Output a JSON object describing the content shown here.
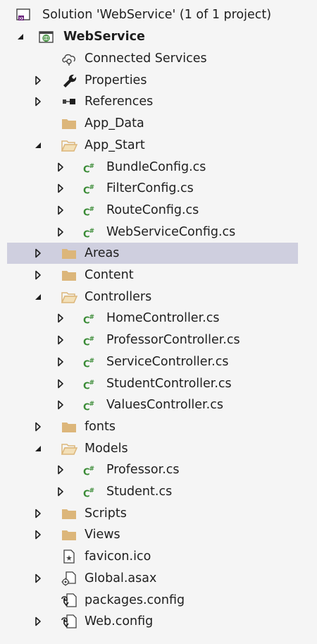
{
  "solution_explorer": {
    "solution_label": "Solution 'WebService' (1 of 1 project)",
    "project_label": "WebService",
    "items": [
      {
        "label": "Connected Services",
        "icon": "connected-services-icon",
        "expander": "none",
        "level": 1
      },
      {
        "label": "Properties",
        "icon": "wrench-icon",
        "expander": "collapsed",
        "level": 1
      },
      {
        "label": "References",
        "icon": "references-icon",
        "expander": "collapsed",
        "level": 1
      },
      {
        "label": "App_Data",
        "icon": "folder-icon",
        "expander": "none",
        "level": 1
      },
      {
        "label": "App_Start",
        "icon": "folder-open-icon",
        "expander": "expanded",
        "level": 1
      },
      {
        "label": "BundleConfig.cs",
        "icon": "csharp-file-icon",
        "expander": "collapsed",
        "level": 2
      },
      {
        "label": "FilterConfig.cs",
        "icon": "csharp-file-icon",
        "expander": "collapsed",
        "level": 2
      },
      {
        "label": "RouteConfig.cs",
        "icon": "csharp-file-icon",
        "expander": "collapsed",
        "level": 2
      },
      {
        "label": "WebServiceConfig.cs",
        "icon": "csharp-file-icon",
        "expander": "collapsed",
        "level": 2
      },
      {
        "label": "Areas",
        "icon": "folder-icon",
        "expander": "collapsed",
        "level": 1,
        "selected": true
      },
      {
        "label": "Content",
        "icon": "folder-icon",
        "expander": "collapsed",
        "level": 1
      },
      {
        "label": "Controllers",
        "icon": "folder-open-icon",
        "expander": "expanded",
        "level": 1
      },
      {
        "label": "HomeController.cs",
        "icon": "csharp-file-icon",
        "expander": "collapsed",
        "level": 2
      },
      {
        "label": "ProfessorController.cs",
        "icon": "csharp-file-icon",
        "expander": "collapsed",
        "level": 2
      },
      {
        "label": "ServiceController.cs",
        "icon": "csharp-file-icon",
        "expander": "collapsed",
        "level": 2
      },
      {
        "label": "StudentController.cs",
        "icon": "csharp-file-icon",
        "expander": "collapsed",
        "level": 2
      },
      {
        "label": "ValuesController.cs",
        "icon": "csharp-file-icon",
        "expander": "collapsed",
        "level": 2
      },
      {
        "label": "fonts",
        "icon": "folder-icon",
        "expander": "collapsed",
        "level": 1
      },
      {
        "label": "Models",
        "icon": "folder-open-icon",
        "expander": "expanded",
        "level": 1
      },
      {
        "label": "Professor.cs",
        "icon": "csharp-file-icon",
        "expander": "collapsed",
        "level": 2
      },
      {
        "label": "Student.cs",
        "icon": "csharp-file-icon",
        "expander": "collapsed",
        "level": 2
      },
      {
        "label": "Scripts",
        "icon": "folder-icon",
        "expander": "collapsed",
        "level": 1
      },
      {
        "label": "Views",
        "icon": "folder-icon",
        "expander": "collapsed",
        "level": 1
      },
      {
        "label": "favicon.ico",
        "icon": "ico-file-icon",
        "expander": "none",
        "level": 1
      },
      {
        "label": "Global.asax",
        "icon": "asax-file-icon",
        "expander": "collapsed",
        "level": 1
      },
      {
        "label": "packages.config",
        "icon": "config-file-icon",
        "expander": "none",
        "level": 1
      },
      {
        "label": "Web.config",
        "icon": "config-file-icon",
        "expander": "collapsed",
        "level": 1
      }
    ],
    "colors": {
      "background": "#f5f5f5",
      "selected_row": "#cfcfdf",
      "folder": "#dcb67a",
      "csharp": "#388a34",
      "vs_purple": "#68217a",
      "text": "#1e1e1e"
    }
  }
}
